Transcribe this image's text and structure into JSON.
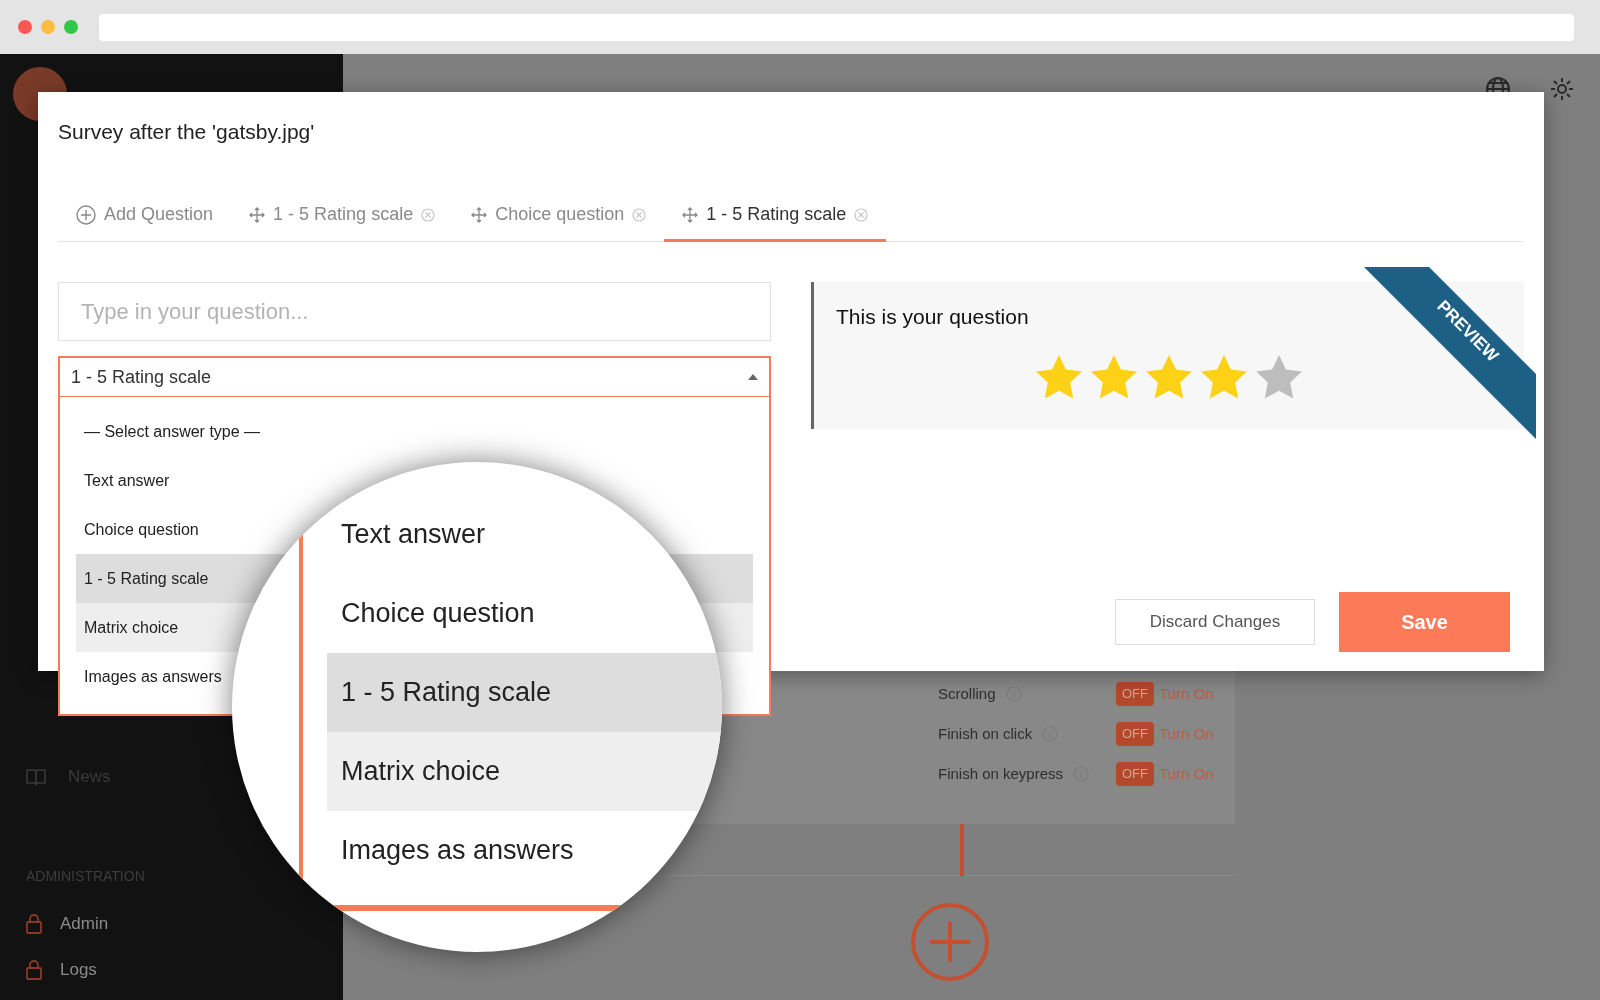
{
  "sidebar": {
    "items": [
      {
        "label": "News",
        "kind": "book"
      }
    ],
    "sections": [
      {
        "heading": "ADMINISTRATION",
        "items": [
          {
            "label": "Admin",
            "kind": "lock"
          },
          {
            "label": "Logs",
            "kind": "lock"
          }
        ]
      }
    ]
  },
  "settings": [
    {
      "label": "Scrolling",
      "on": false,
      "state": "OFF",
      "action": "Turn On"
    },
    {
      "label": "Finish on click",
      "on": false,
      "state": "OFF",
      "action": "Turn On"
    },
    {
      "label": "Finish on keypress",
      "on": false,
      "state": "OFF",
      "action": "Turn On"
    }
  ],
  "modal": {
    "title": "Survey after the 'gatsby.jpg'",
    "tabs": [
      {
        "label": "Add Question",
        "kind": "add",
        "selected": false
      },
      {
        "label": "1 - 5 Rating scale",
        "kind": "question",
        "selected": false
      },
      {
        "label": "Choice question",
        "kind": "question",
        "selected": false
      },
      {
        "label": "1 - 5 Rating scale",
        "kind": "question",
        "selected": true
      }
    ],
    "question": {
      "placeholder": "Type in your question..."
    },
    "answer_type": {
      "value": "1 - 5 Rating scale",
      "expanded": true,
      "options": [
        {
          "label": "— Select answer type —",
          "selected": false,
          "hovered": false
        },
        {
          "label": "Text answer",
          "selected": false,
          "hovered": false
        },
        {
          "label": "Choice question",
          "selected": false,
          "hovered": false
        },
        {
          "label": "1 - 5 Rating scale",
          "selected": true,
          "hovered": false
        },
        {
          "label": "Matrix choice",
          "selected": false,
          "hovered": true
        },
        {
          "label": "Images as answers",
          "selected": false,
          "hovered": false
        }
      ]
    },
    "preview": {
      "ribbon": "PREVIEW",
      "question": "This is your question",
      "stars": 4
    },
    "buttons": [
      {
        "label": "Discard Changes",
        "kind": "secondary"
      },
      {
        "label": "Save",
        "kind": "primary"
      }
    ]
  },
  "magnifier": {
    "options": [
      {
        "label": "Text answer",
        "selected": false,
        "hovered": false
      },
      {
        "label": "Choice question",
        "selected": false,
        "hovered": false
      },
      {
        "label": "1 - 5 Rating scale",
        "selected": true,
        "hovered": false
      },
      {
        "label": "Matrix choice",
        "selected": false,
        "hovered": true
      },
      {
        "label": "Images as answers",
        "selected": false,
        "hovered": false
      }
    ]
  }
}
